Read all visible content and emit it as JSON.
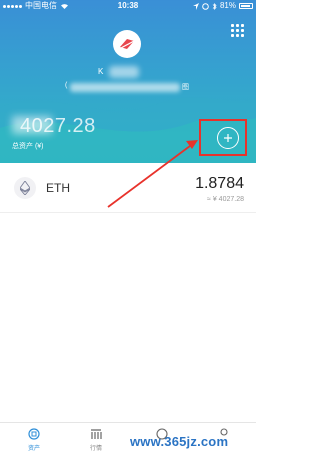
{
  "status_bar": {
    "carrier": "中国电信",
    "time": "10:38",
    "battery": "81%"
  },
  "wallet": {
    "account_initial": "K",
    "address_start": "(",
    "address_end": "图",
    "total_value": "4027.28",
    "total_label": "总资产 (¥)"
  },
  "tokens": [
    {
      "symbol": "ETH",
      "balance": "1.8784",
      "approx": "≈",
      "value": "¥ 4027.28"
    }
  ],
  "tabbar": {
    "tabs": [
      {
        "label": "资产"
      },
      {
        "label": "行情"
      }
    ]
  },
  "watermark": "www.365jz.com",
  "colors": {
    "header_top": "#3a8fd6",
    "header_bottom": "#2fb8c2",
    "highlight": "#e8322b",
    "active_tab": "#2f8fd8"
  }
}
